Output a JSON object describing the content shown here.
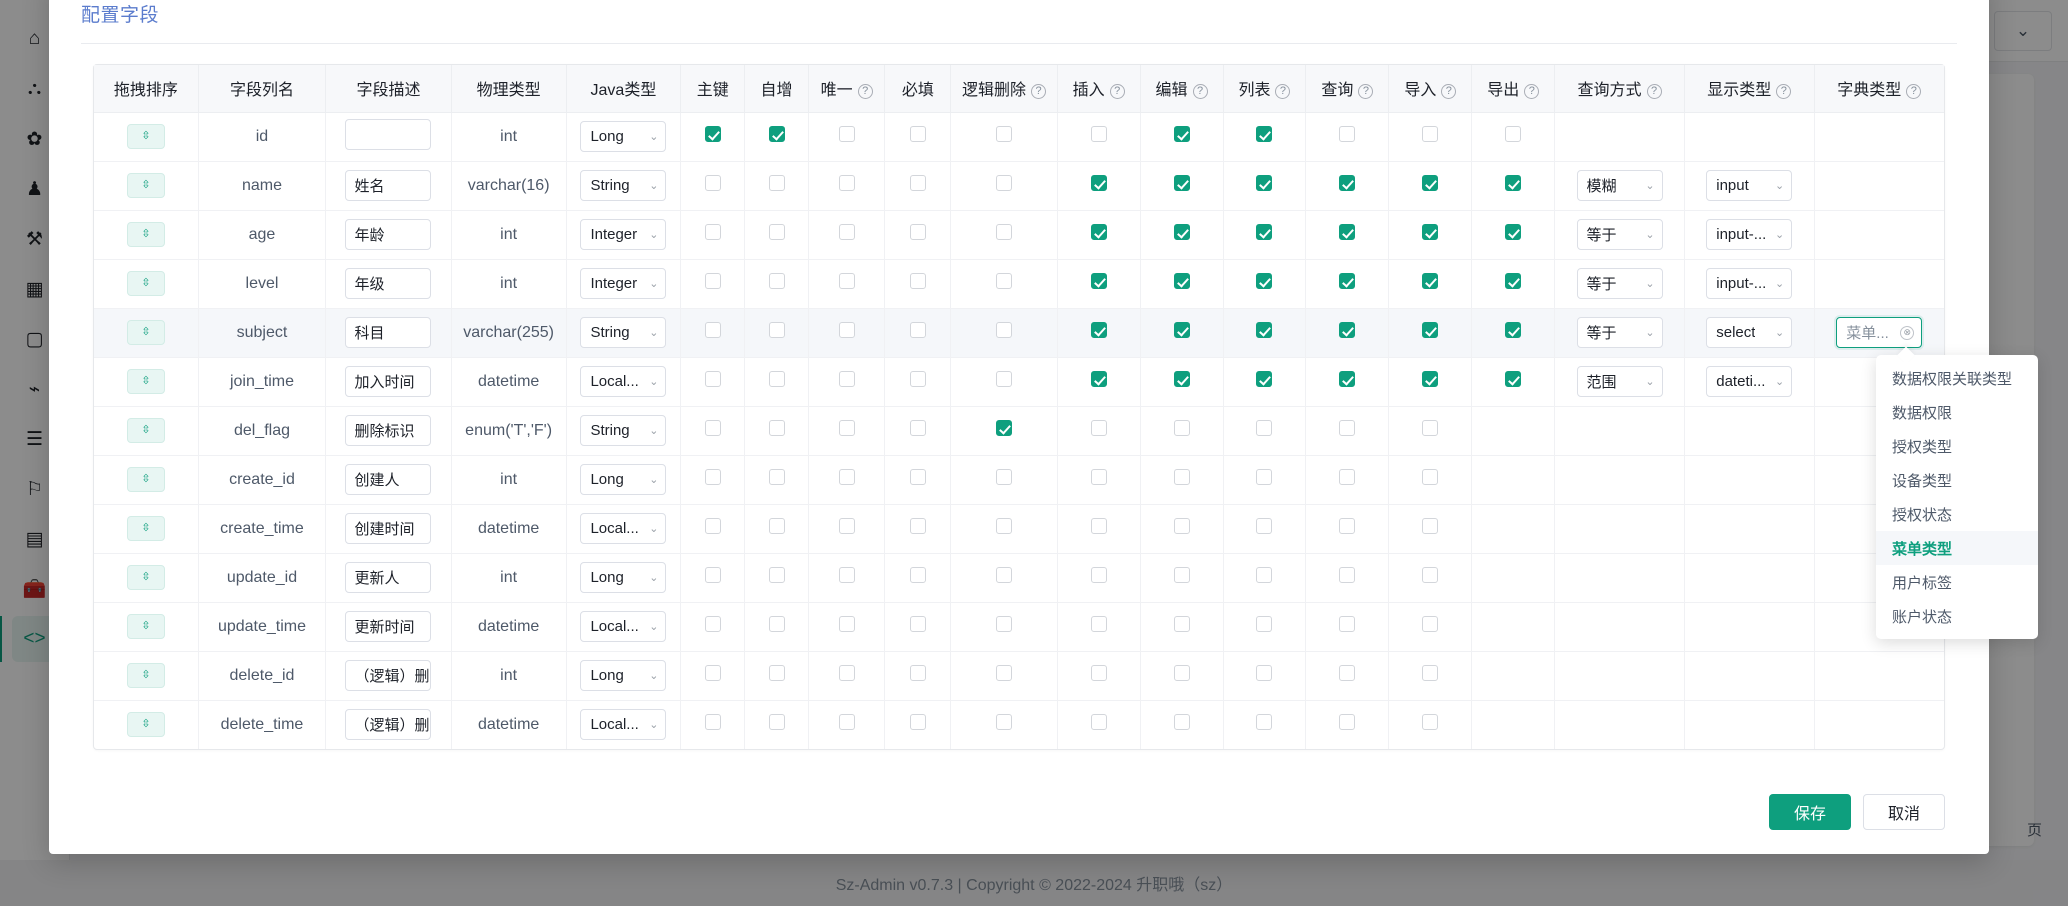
{
  "background": {
    "sidebar_icons": [
      "home-icon",
      "sitemap-icon",
      "gear-icon",
      "user-icon",
      "wrench-icon",
      "grid-icon",
      "window-icon",
      "plug-icon",
      "list-icon",
      "bookmark-icon",
      "database-icon",
      "toolbox-icon",
      "code-icon"
    ],
    "topbar_icons": [
      "chevron-down-icon",
      "layout-icon",
      "search-icon"
    ],
    "footer_text": "Sz-Admin v0.7.3 | Copyright © 2022-2024 升职哦（sz）",
    "page_label": "页"
  },
  "modal": {
    "title": "配置字段",
    "save_label": "保存",
    "cancel_label": "取消"
  },
  "table": {
    "columns": [
      {
        "label": "拖拽排序",
        "help": false
      },
      {
        "label": "字段列名",
        "help": false
      },
      {
        "label": "字段描述",
        "help": false
      },
      {
        "label": "物理类型",
        "help": false
      },
      {
        "label": "Java类型",
        "help": false
      },
      {
        "label": "主键",
        "help": false
      },
      {
        "label": "自增",
        "help": false
      },
      {
        "label": "唯一",
        "help": true
      },
      {
        "label": "必填",
        "help": false
      },
      {
        "label": "逻辑删除",
        "help": true
      },
      {
        "label": "插入",
        "help": true
      },
      {
        "label": "编辑",
        "help": true
      },
      {
        "label": "列表",
        "help": true
      },
      {
        "label": "查询",
        "help": true
      },
      {
        "label": "导入",
        "help": true
      },
      {
        "label": "导出",
        "help": true
      },
      {
        "label": "查询方式",
        "help": true
      },
      {
        "label": "显示类型",
        "help": true
      },
      {
        "label": "字典类型",
        "help": true
      }
    ],
    "help_symbol": "?",
    "drag_handle": "⇳",
    "rows": [
      {
        "name": "id",
        "desc": "",
        "phys": "int",
        "java": "Long",
        "pk": true,
        "auto": true,
        "uniq": false,
        "req": false,
        "del": false,
        "ins": false,
        "edit": true,
        "list": true,
        "query": false,
        "imp": false,
        "exp": false,
        "qmode": "",
        "dtype": "",
        "dict": "",
        "highlight": false,
        "hide_exp": false
      },
      {
        "name": "name",
        "desc": "姓名",
        "phys": "varchar(16)",
        "java": "String",
        "pk": false,
        "auto": false,
        "uniq": false,
        "req": false,
        "del": false,
        "ins": true,
        "edit": true,
        "list": true,
        "query": true,
        "imp": true,
        "exp": true,
        "qmode": "模糊",
        "dtype": "input",
        "dict": "",
        "highlight": false,
        "hide_exp": false
      },
      {
        "name": "age",
        "desc": "年龄",
        "phys": "int",
        "java": "Integer",
        "pk": false,
        "auto": false,
        "uniq": false,
        "req": false,
        "del": false,
        "ins": true,
        "edit": true,
        "list": true,
        "query": true,
        "imp": true,
        "exp": true,
        "qmode": "等于",
        "dtype": "input-...",
        "dict": "",
        "highlight": false,
        "hide_exp": false
      },
      {
        "name": "level",
        "desc": "年级",
        "phys": "int",
        "java": "Integer",
        "pk": false,
        "auto": false,
        "uniq": false,
        "req": false,
        "del": false,
        "ins": true,
        "edit": true,
        "list": true,
        "query": true,
        "imp": true,
        "exp": true,
        "qmode": "等于",
        "dtype": "input-...",
        "dict": "",
        "highlight": false,
        "hide_exp": false
      },
      {
        "name": "subject",
        "desc": "科目",
        "phys": "varchar(255)",
        "java": "String",
        "pk": false,
        "auto": false,
        "uniq": false,
        "req": false,
        "del": false,
        "ins": true,
        "edit": true,
        "list": true,
        "query": true,
        "imp": true,
        "exp": true,
        "qmode": "等于",
        "dtype": "select",
        "dict": "菜单...",
        "highlight": true,
        "hide_exp": false
      },
      {
        "name": "join_time",
        "desc": "加入时间",
        "phys": "datetime",
        "java": "Local...",
        "pk": false,
        "auto": false,
        "uniq": false,
        "req": false,
        "del": false,
        "ins": true,
        "edit": true,
        "list": true,
        "query": true,
        "imp": true,
        "exp": true,
        "qmode": "范围",
        "dtype": "dateti...",
        "dict": "",
        "highlight": false,
        "hide_exp": false
      },
      {
        "name": "del_flag",
        "desc": "删除标识",
        "phys": "enum('T','F')",
        "java": "String",
        "pk": false,
        "auto": false,
        "uniq": false,
        "req": false,
        "del": true,
        "ins": false,
        "edit": false,
        "list": false,
        "query": false,
        "imp": false,
        "exp": false,
        "qmode": "",
        "dtype": "",
        "dict": "",
        "highlight": false,
        "hide_exp": true
      },
      {
        "name": "create_id",
        "desc": "创建人",
        "phys": "int",
        "java": "Long",
        "pk": false,
        "auto": false,
        "uniq": false,
        "req": false,
        "del": false,
        "ins": false,
        "edit": false,
        "list": false,
        "query": false,
        "imp": false,
        "exp": false,
        "qmode": "",
        "dtype": "",
        "dict": "",
        "highlight": false,
        "hide_exp": true
      },
      {
        "name": "create_time",
        "desc": "创建时间",
        "phys": "datetime",
        "java": "Local...",
        "pk": false,
        "auto": false,
        "uniq": false,
        "req": false,
        "del": false,
        "ins": false,
        "edit": false,
        "list": false,
        "query": false,
        "imp": false,
        "exp": false,
        "qmode": "",
        "dtype": "",
        "dict": "",
        "highlight": false,
        "hide_exp": true
      },
      {
        "name": "update_id",
        "desc": "更新人",
        "phys": "int",
        "java": "Long",
        "pk": false,
        "auto": false,
        "uniq": false,
        "req": false,
        "del": false,
        "ins": false,
        "edit": false,
        "list": false,
        "query": false,
        "imp": false,
        "exp": false,
        "qmode": "",
        "dtype": "",
        "dict": "",
        "highlight": false,
        "hide_exp": true
      },
      {
        "name": "update_time",
        "desc": "更新时间",
        "phys": "datetime",
        "java": "Local...",
        "pk": false,
        "auto": false,
        "uniq": false,
        "req": false,
        "del": false,
        "ins": false,
        "edit": false,
        "list": false,
        "query": false,
        "imp": false,
        "exp": false,
        "qmode": "",
        "dtype": "",
        "dict": "",
        "highlight": false,
        "hide_exp": true
      },
      {
        "name": "delete_id",
        "desc": "（逻辑）删",
        "phys": "int",
        "java": "Long",
        "pk": false,
        "auto": false,
        "uniq": false,
        "req": false,
        "del": false,
        "ins": false,
        "edit": false,
        "list": false,
        "query": false,
        "imp": false,
        "exp": false,
        "qmode": "",
        "dtype": "",
        "dict": "",
        "highlight": false,
        "hide_exp": true
      },
      {
        "name": "delete_time",
        "desc": "（逻辑）删",
        "phys": "datetime",
        "java": "Local...",
        "pk": false,
        "auto": false,
        "uniq": false,
        "req": false,
        "del": false,
        "ins": false,
        "edit": false,
        "list": false,
        "query": false,
        "imp": false,
        "exp": false,
        "qmode": "",
        "dtype": "",
        "dict": "",
        "highlight": false,
        "hide_exp": true
      }
    ]
  },
  "dict_dropdown": {
    "selected": "菜单类型",
    "clear_symbol": "⊗",
    "items": [
      "数据权限关联类型",
      "数据权限",
      "授权类型",
      "设备类型",
      "授权状态",
      "菜单类型",
      "用户标签",
      "账户状态"
    ]
  },
  "colors": {
    "accent": "#0e9f7e",
    "title": "#5b7ccd",
    "header_bg": "#f7f8fa"
  }
}
